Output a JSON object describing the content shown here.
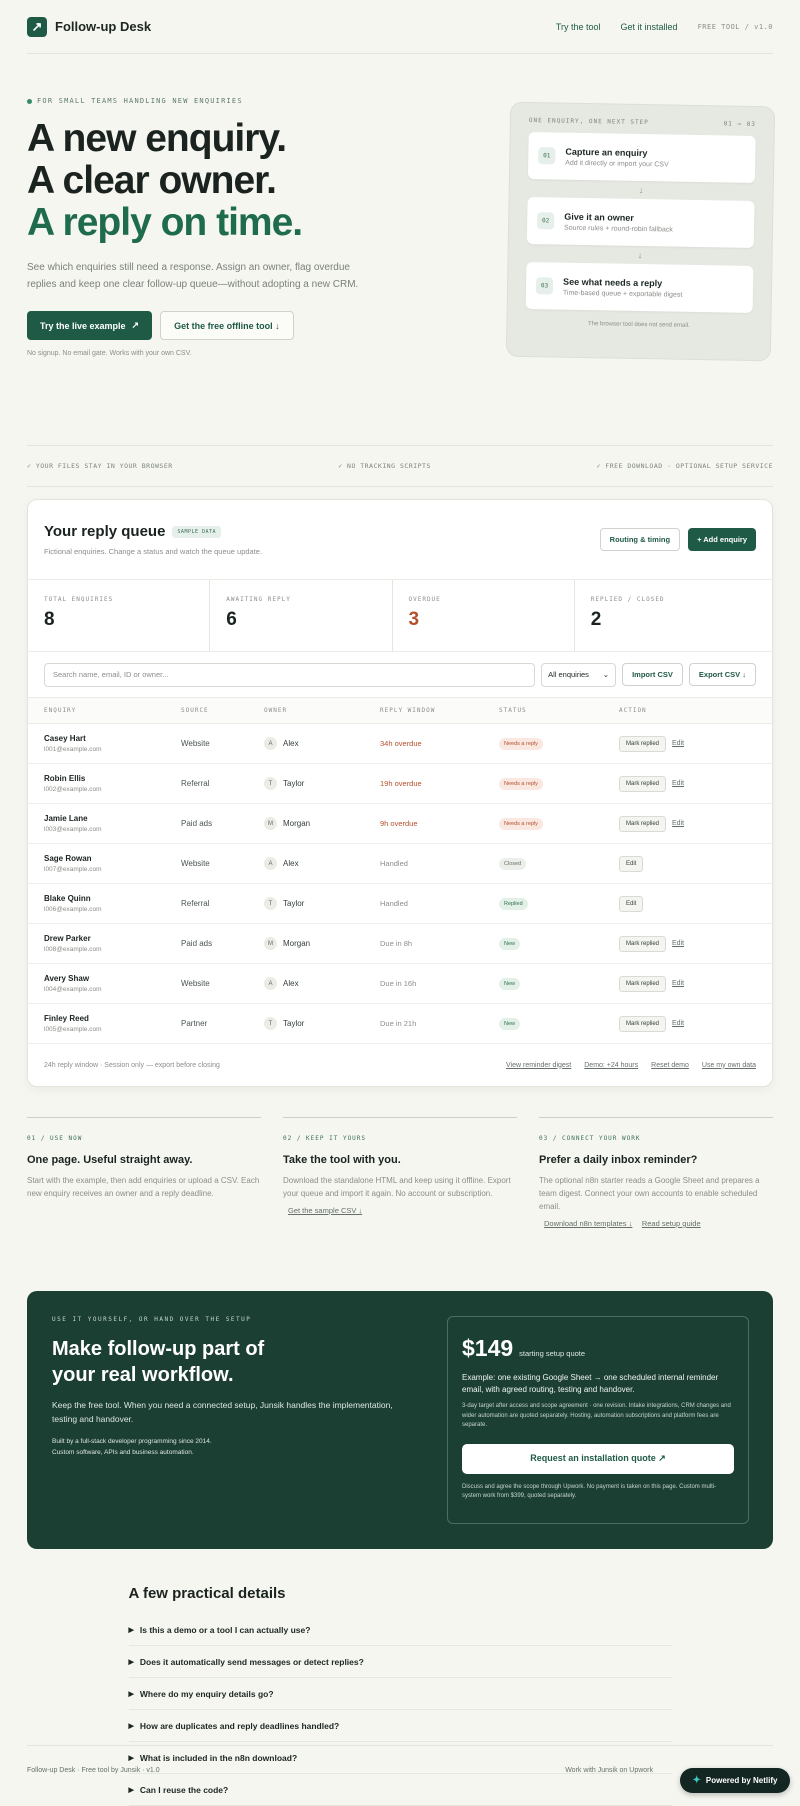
{
  "header": {
    "brand": "Follow-up Desk",
    "logo_glyph": "↗",
    "nav": [
      "Try the tool",
      "Get it installed"
    ],
    "tag": "FREE TOOL / v1.0"
  },
  "hero": {
    "eyebrow": "FOR SMALL TEAMS HANDLING NEW ENQUIRIES",
    "line1": "A new enquiry.",
    "line2": "A clear owner.",
    "line3": "A reply on time.",
    "sub": "See which enquiries still need a response. Assign an owner, flag overdue replies and keep one clear follow-up queue—without adopting a new CRM.",
    "primary_btn": "Try the live example",
    "primary_icon": "↗",
    "secondary_btn": "Get the free offline tool ↓",
    "note": "No signup. No email gate. Works with your own CSV."
  },
  "steps": {
    "title": "ONE ENQUIRY, ONE NEXT STEP",
    "range": "01 → 03",
    "items": [
      {
        "num": "01",
        "title": "Capture an enquiry",
        "sub": "Add it directly or import your CSV"
      },
      {
        "num": "02",
        "title": "Give it an owner",
        "sub": "Source rules + round-robin fallback"
      },
      {
        "num": "03",
        "title": "See what needs a reply",
        "sub": "Time-based queue + exportable digest"
      }
    ],
    "arrow": "↓",
    "footnote": "The browser tool does not send email."
  },
  "trust": [
    "✓ YOUR FILES STAY IN YOUR BROWSER",
    "✓ NO TRACKING SCRIPTS",
    "✓ FREE DOWNLOAD · OPTIONAL SETUP SERVICE"
  ],
  "queue": {
    "title": "Your reply queue",
    "badge": "SAMPLE DATA",
    "sub": "Fictional enquiries. Change a status and watch the queue update.",
    "routing_btn": "Routing & timing",
    "add_btn": "+ Add enquiry",
    "stats": [
      {
        "label": "TOTAL ENQUIRIES",
        "value": "8"
      },
      {
        "label": "AWAITING REPLY",
        "value": "6"
      },
      {
        "label": "OVERDUE",
        "value": "3"
      },
      {
        "label": "REPLIED / CLOSED",
        "value": "2"
      }
    ],
    "search_placeholder": "Search name, email, ID or owner...",
    "filter": "All enquiries",
    "filter_icon": "⌄",
    "import_btn": "Import CSV",
    "export_btn": "Export CSV ↓",
    "columns": [
      "ENQUIRY",
      "SOURCE",
      "OWNER",
      "REPLY WINDOW",
      "STATUS",
      "ACTION"
    ],
    "rows": [
      {
        "name": "Casey Hart",
        "email": "l001@example.com",
        "source": "Website",
        "owner_initial": "A",
        "owner": "Alex",
        "window": "34h overdue",
        "status": "Needs a reply",
        "action": "Mark replied",
        "edit": "Edit"
      },
      {
        "name": "Robin Ellis",
        "email": "l002@example.com",
        "source": "Referral",
        "owner_initial": "T",
        "owner": "Taylor",
        "window": "19h overdue",
        "status": "Needs a reply",
        "action": "Mark replied",
        "edit": "Edit"
      },
      {
        "name": "Jamie Lane",
        "email": "l003@example.com",
        "source": "Paid ads",
        "owner_initial": "M",
        "owner": "Morgan",
        "window": "9h overdue",
        "status": "Needs a reply",
        "action": "Mark replied",
        "edit": "Edit"
      },
      {
        "name": "Sage Rowan",
        "email": "l007@example.com",
        "source": "Website",
        "owner_initial": "A",
        "owner": "Alex",
        "window": "Handled",
        "status": "Closed",
        "action": "Edit",
        "edit": ""
      },
      {
        "name": "Blake Quinn",
        "email": "l006@example.com",
        "source": "Referral",
        "owner_initial": "T",
        "owner": "Taylor",
        "window": "Handled",
        "status": "Replied",
        "action": "Edit",
        "edit": ""
      },
      {
        "name": "Drew Parker",
        "email": "l008@example.com",
        "source": "Paid ads",
        "owner_initial": "M",
        "owner": "Morgan",
        "window": "Due in 8h",
        "status": "New",
        "action": "Mark replied",
        "edit": "Edit"
      },
      {
        "name": "Avery Shaw",
        "email": "l004@example.com",
        "source": "Website",
        "owner_initial": "A",
        "owner": "Alex",
        "window": "Due in 16h",
        "status": "New",
        "action": "Mark replied",
        "edit": "Edit"
      },
      {
        "name": "Finley Reed",
        "email": "l005@example.com",
        "source": "Partner",
        "owner_initial": "T",
        "owner": "Taylor",
        "window": "Due in 21h",
        "status": "New",
        "action": "Mark replied",
        "edit": "Edit"
      }
    ],
    "foot_note": "24h reply window · Session only — export before closing",
    "foot_links": [
      "View reminder digest",
      "Demo: +24 hours",
      "Reset demo",
      "Use my own data"
    ]
  },
  "features": [
    {
      "tag": "01 / USE NOW",
      "title": "One page. Useful straight away.",
      "body": "Start with the example, then add enquiries or upload a CSV. Each new enquiry receives an owner and a reply deadline.",
      "links": []
    },
    {
      "tag": "02 / KEEP IT YOURS",
      "title": "Take the tool with you.",
      "body": "Download the standalone HTML and keep using it offline. Export your queue and import it again. No account or subscription.",
      "links": [
        "Get the sample CSV ↓"
      ]
    },
    {
      "tag": "03 / CONNECT YOUR WORK",
      "title": "Prefer a daily inbox reminder?",
      "body": "The optional n8n starter reads a Google Sheet and prepares a team digest. Connect your own accounts to enable scheduled email.",
      "links": [
        "Download n8n templates ↓",
        "Read setup guide"
      ]
    }
  ],
  "cta": {
    "eyebrow": "USE IT YOURSELF, OR HAND OVER THE SETUP",
    "title": "Make follow-up part of your real workflow.",
    "body": "Keep the free tool. When you need a connected setup, Junsik handles the implementation, testing and handover.",
    "cred1": "Built by a full-stack developer programming since 2014.",
    "cred2": "Custom software, APIs and business automation.",
    "price": "$149",
    "price_label": "starting setup quote",
    "example": "Example: one existing Google Sheet → one scheduled internal reminder email, with agreed routing, testing and handover.",
    "terms": "3-day target after access and scope agreement · one revision. Intake integrations, CRM changes and wider automation are quoted separately. Hosting, automation subscriptions and platform fees are separate.",
    "quote_btn": "Request an installation quote ↗",
    "foot": "Discuss and agree the scope through Upwork. No payment is taken on this page. Custom multi-system work from $399, quoted separately."
  },
  "faq": {
    "title": "A few practical details",
    "items": [
      "Is this a demo or a tool I can actually use?",
      "Does it automatically send messages or detect replies?",
      "Where do my enquiry details go?",
      "How are duplicates and reply deadlines handled?",
      "What is included in the n8n download?",
      "Can I reuse the code?"
    ]
  },
  "footer": {
    "left": "Follow-up Desk · Free tool by Junsik · v1.0",
    "right": "Work with Junsik on Upwork"
  },
  "netlify": {
    "label": "Powered by Netlify",
    "icon": "netlify-icon"
  }
}
